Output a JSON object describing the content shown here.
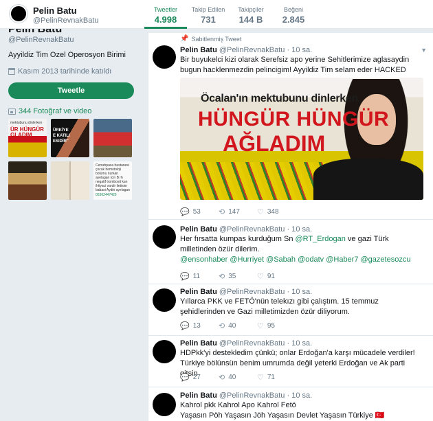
{
  "profile": {
    "name": "Pelin Batu",
    "handle": "@PelinRevnakBatu",
    "bio": "Ayyildiz Tim Ozel Operosyon Birimi",
    "joined": "Kasım 2013 tarihinde katıldı",
    "tweet_button": "Tweetle",
    "media_label": "344 Fotoğraf ve video"
  },
  "nav": {
    "stats": [
      {
        "label": "Tweetler",
        "value": "4.998",
        "active": true
      },
      {
        "label": "Takip Edilen",
        "value": "731"
      },
      {
        "label": "Takipçiler",
        "value": "144 B"
      },
      {
        "label": "Beğeni",
        "value": "2.845"
      }
    ]
  },
  "thumbnails": [
    {
      "text": "mektubunu dinlerken",
      "big": "ÜR HÜNGÜR",
      "big2": "GLADIM"
    },
    {
      "text": "ÜRKİYE",
      "text2": "E KATILI",
      "text3": "ESIDİR\""
    },
    {},
    {},
    {},
    {
      "text": "Cerrahpasa hastanesi çocuk hemotoloji bolumu nurkan ayelagan icin B rh negatif trombosit kan ihtiyaci vardir iletisim babasi Aydin ayelagan",
      "link": "05362447429"
    }
  ],
  "timeline": {
    "pinned_label": "Sabitlenmiş Tweet",
    "tweets": [
      {
        "name": "Pelin Batu",
        "handle": "@PelinRevnakBatu",
        "time": "· 10 sa.",
        "text": "Bir buyukelci kizi olarak Serefsiz apo yerine Sehitlerimize aglasaydin bugun hacklenmezdin pelincigim! Ayyildiz Tim selam eder HACKED",
        "media": {
          "subhead": "Öcalan'ın mektubunu dinlerken",
          "line1": "HÜNGÜR HÜNGÜR",
          "line2": "AĞLADIM"
        },
        "replies": "53",
        "retweets": "147",
        "likes": "348"
      },
      {
        "name": "Pelin Batu",
        "handle": "@PelinRevnakBatu",
        "time": "· 10 sa.",
        "text_a": "Her fırsatta kumpas kurduğum Sn ",
        "mention": "@RT_Erdogan",
        "text_b": " ve gazi Türk milletinden özür dilerim.",
        "mentions_line": "@ensonhaber @Hurriyet @Sabah @odatv @Haber7 @gazetesozcu",
        "replies": "11",
        "retweets": "35",
        "likes": "91"
      },
      {
        "name": "Pelin Batu",
        "handle": "@PelinRevnakBatu",
        "time": "· 10 sa.",
        "text": "Yıllarca PKK ve FETÖ'nün telekızı gibi çalıştım. 15 temmuz şehidlerinden ve Gazi milletimizden özür diliyorum.",
        "replies": "13",
        "retweets": "40",
        "likes": "95"
      },
      {
        "name": "Pelin Batu",
        "handle": "@PelinRevnakBatu",
        "time": "· 10 sa.",
        "text": "HDPkk'yi destekledim çünkü; onlar Erdoğan'a karşı mücadele verdiler! Türkiye bölünsün benim umrumda değil yeterki Erdoğan ve Ak parti gitsin",
        "replies": "27",
        "retweets": "40",
        "likes": "71"
      },
      {
        "name": "Pelin Batu",
        "handle": "@PelinRevnakBatu",
        "time": "· 10 sa.",
        "line1": "Kahrol pkk Kahrol Apo Kahrol Fetö",
        "line2": "Yaşasın Pöh Yaşasın Jöh Yaşasın Devlet Yaşasın Türkiye 🇹🇷"
      }
    ]
  },
  "colors": {
    "accent": "#1a8a5a",
    "background": "#e6ecf0"
  }
}
